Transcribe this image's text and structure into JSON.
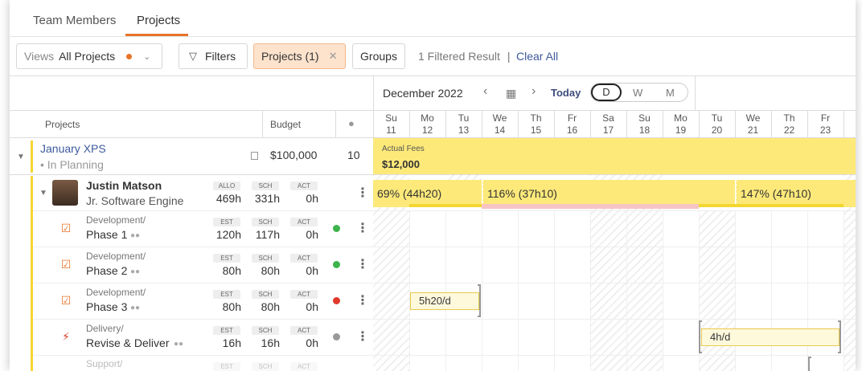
{
  "tabs": [
    {
      "label": "Team Members"
    },
    {
      "label": "Projects"
    }
  ],
  "toolbar": {
    "views_label": "Views",
    "views_value": "All Projects",
    "filters_label": "Filters",
    "project_chip": "Projects (1)",
    "groups_label": "Groups",
    "filtered_result": "1 Filtered Result",
    "separator": "|",
    "clear_all": "Clear All"
  },
  "calendar": {
    "month": "December 2022",
    "today_label": "Today",
    "scales": [
      "D",
      "W",
      "M"
    ],
    "days": [
      {
        "dow": "Su",
        "date": "11"
      },
      {
        "dow": "Mo",
        "date": "12"
      },
      {
        "dow": "Tu",
        "date": "13"
      },
      {
        "dow": "We",
        "date": "14"
      },
      {
        "dow": "Th",
        "date": "15"
      },
      {
        "dow": "Fr",
        "date": "16"
      },
      {
        "dow": "Sa",
        "date": "17"
      },
      {
        "dow": "Su",
        "date": "18"
      },
      {
        "dow": "Mo",
        "date": "19"
      },
      {
        "dow": "Tu",
        "date": "20"
      },
      {
        "dow": "We",
        "date": "21"
      },
      {
        "dow": "Th",
        "date": "22"
      },
      {
        "dow": "Fr",
        "date": "23"
      }
    ]
  },
  "columns": {
    "projects": "Projects",
    "budget": "Budget"
  },
  "project": {
    "name": "January XPS",
    "status": "In Planning",
    "budget": "$100,000",
    "count": "10",
    "fees_label": "Actual Fees",
    "fees_value": "$12,000"
  },
  "member": {
    "name": "Justin Matson",
    "role": "Jr. Software Engineer",
    "stats": [
      {
        "label": "ALLO",
        "value": "469h"
      },
      {
        "label": "SCH",
        "value": "331h"
      },
      {
        "label": "ACT",
        "value": "0h"
      }
    ],
    "allocations": [
      "69% (44h20)",
      "116% (37h10)",
      "147% (47h10)"
    ]
  },
  "tasks": [
    {
      "type": "Development/",
      "name": "Phase 1",
      "est": "120h",
      "sch": "117h",
      "act": "0h",
      "status_color": "#3cb44b"
    },
    {
      "type": "Development/",
      "name": "Phase 2",
      "est": "80h",
      "sch": "80h",
      "act": "0h",
      "status_color": "#3cb44b"
    },
    {
      "type": "Development/",
      "name": "Phase 3",
      "est": "80h",
      "sch": "80h",
      "act": "0h",
      "status_color": "#e0392b",
      "bar": "5h20/d"
    },
    {
      "type": "Delivery/",
      "name": "Revise & Deliver",
      "est": "16h",
      "sch": "16h",
      "act": "0h",
      "status_color": "#999999",
      "bar": "4h/d"
    },
    {
      "type": "Support/",
      "name": "",
      "est": "",
      "sch": "",
      "act": ""
    }
  ],
  "stat_labels": {
    "est": "EST",
    "sch": "SCH",
    "act": "ACT"
  }
}
